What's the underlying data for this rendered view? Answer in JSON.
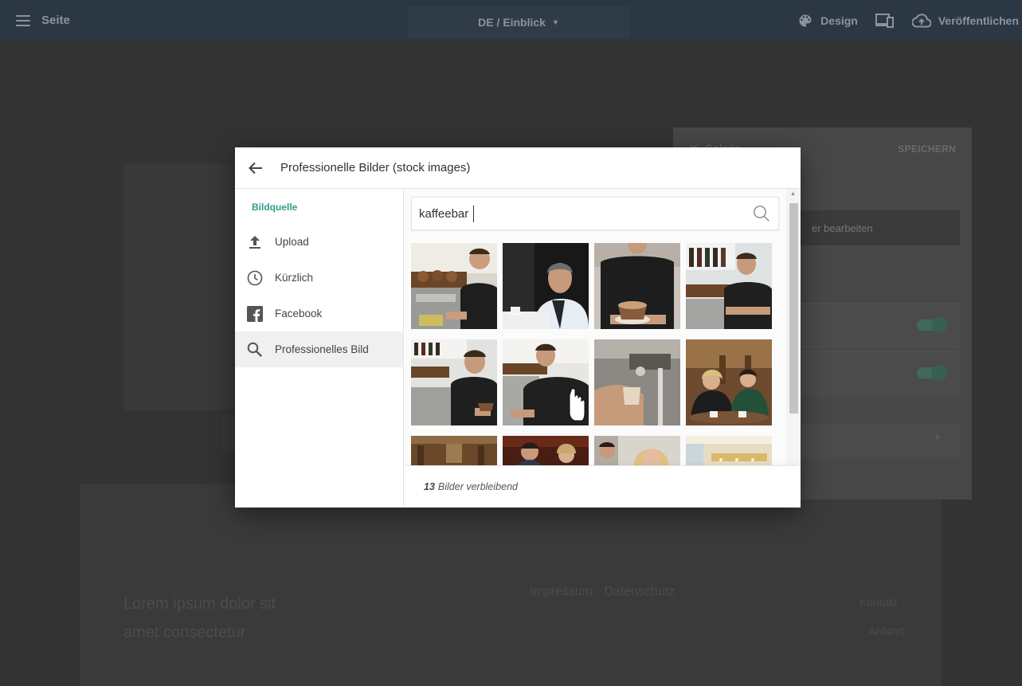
{
  "app": {
    "menu_label": "Seite",
    "language_page": "DE / Einblick",
    "design_label": "Design",
    "publish_label": "Veröffentlichen"
  },
  "side_panel": {
    "title": "Galerie",
    "save_label": "SPEICHERN",
    "edit_label": "er bearbeiten"
  },
  "background_text": {
    "left": "Lorem ipsum dolor sit amet consectetur",
    "middle": "Impressum · Datenschutz",
    "right": "Kontakt · Anfahrt"
  },
  "modal": {
    "title": "Professionelle Bilder (stock images)",
    "section_label": "Bildquelle",
    "nav": [
      {
        "label": "Upload",
        "icon": "upload-icon"
      },
      {
        "label": "Kürzlich",
        "icon": "clock-icon"
      },
      {
        "label": "Facebook",
        "icon": "facebook-icon"
      },
      {
        "label": "Professionelles Bild",
        "icon": "search-icon"
      }
    ],
    "active_nav": "Professionelles Bild",
    "search": {
      "value": "kaffeebar",
      "placeholder": ""
    },
    "images": [
      {
        "subject": "barista-coffee-machine-smiling"
      },
      {
        "subject": "man-at-cafe-table-portrait"
      },
      {
        "subject": "barista-serving-latte"
      },
      {
        "subject": "barista-arms-crossed-bar"
      },
      {
        "subject": "barista-holding-cup"
      },
      {
        "subject": "barista-at-counter"
      },
      {
        "subject": "espresso-machine-closeup"
      },
      {
        "subject": "two-women-at-cafe-table"
      },
      {
        "subject": "cafe-interior-wooden"
      },
      {
        "subject": "couple-at-bar"
      },
      {
        "subject": "blonde-woman-smiling"
      },
      {
        "subject": "bright-cafe-interior"
      }
    ],
    "remaining_count": "13",
    "remaining_label": "Bilder verbleibend"
  },
  "colors": {
    "accent": "#2e9e8a",
    "topbar": "#2c3744",
    "overlay": "#333333"
  }
}
